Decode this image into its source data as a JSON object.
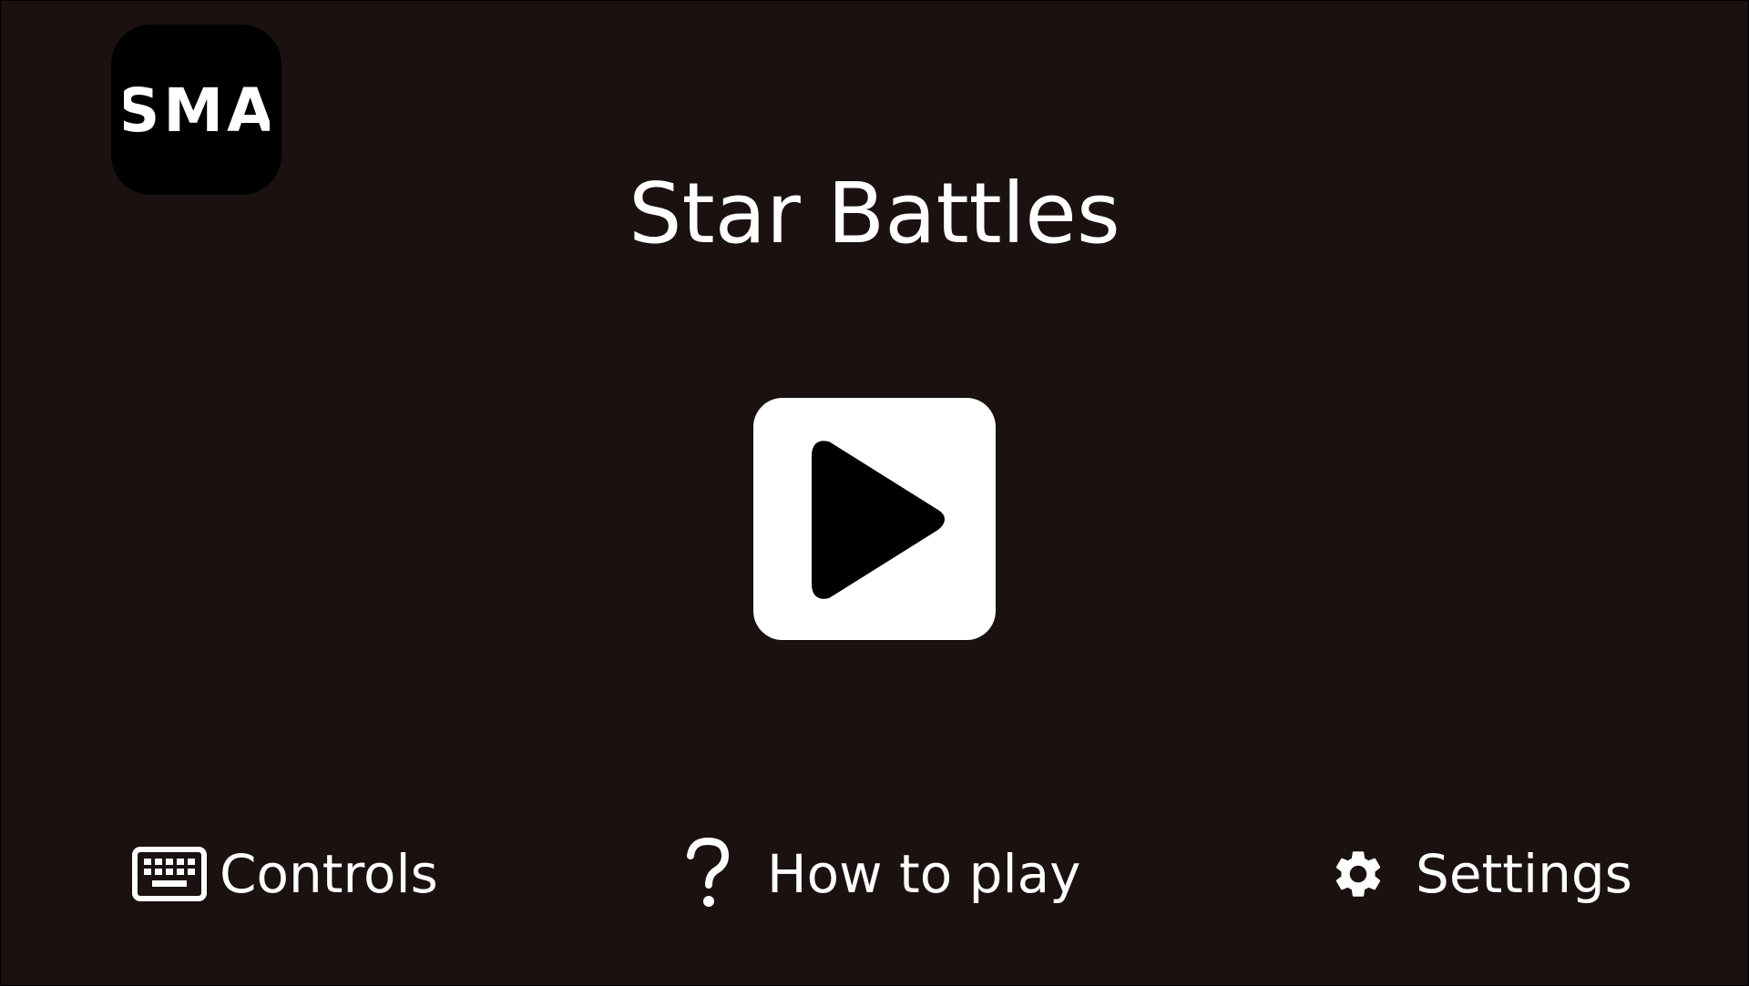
{
  "logo": {
    "text": "SMA",
    "icon": "sma-logo-icon"
  },
  "title": "Star Battles",
  "play_button": {
    "icon": "play-icon"
  },
  "menu": {
    "controls": {
      "label": "Controls",
      "icon": "keyboard-icon"
    },
    "how_to_play": {
      "label": "How to play",
      "icon": "question-mark-icon"
    },
    "settings": {
      "label": "Settings",
      "icon": "gear-icon"
    }
  },
  "colors": {
    "background": "#1a1110",
    "foreground": "#ffffff",
    "logo_background": "#000000"
  }
}
